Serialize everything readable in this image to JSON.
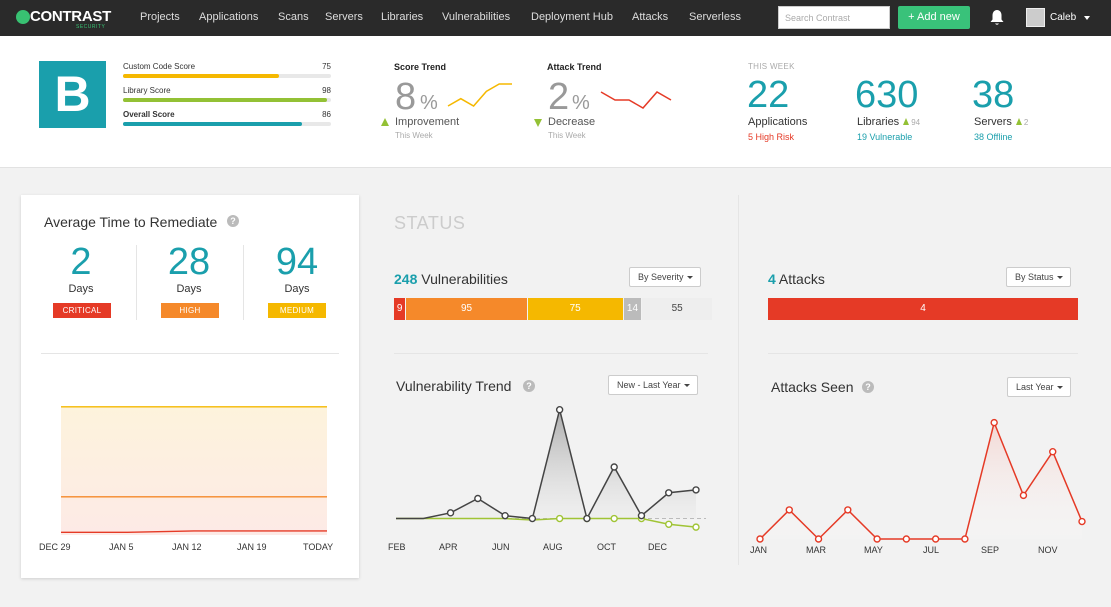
{
  "nav": {
    "logo": "CONTRAST",
    "logo_sub": "SECURITY",
    "items": [
      "Projects",
      "Applications",
      "Scans",
      "Servers",
      "Libraries",
      "Vulnerabilities",
      "Deployment Hub",
      "Attacks",
      "Serverless"
    ],
    "search_placeholder": "Search Contrast",
    "add_new": "+ Add new",
    "user": "Caleb"
  },
  "header": {
    "grade": "B",
    "scores": [
      {
        "label": "Custom Code Score",
        "value": "75",
        "percent": 75,
        "color": "#f5b800",
        "bold": false
      },
      {
        "label": "Library Score",
        "value": "98",
        "percent": 98,
        "color": "#93c135",
        "bold": false
      },
      {
        "label": "Overall Score",
        "value": "86",
        "percent": 86,
        "color": "#1a9fac",
        "bold": true
      }
    ],
    "score_trend": {
      "title": "Score Trend",
      "value": "8",
      "unit": "%",
      "direction": "Improvement",
      "period": "This Week"
    },
    "attack_trend": {
      "title": "Attack Trend",
      "value": "2",
      "unit": "%",
      "direction": "Decrease",
      "period": "This Week"
    },
    "this_week": "THIS WEEK",
    "applications": {
      "value": "22",
      "label": "Applications",
      "sub": "5 High Risk",
      "sub_color": "#e53a26"
    },
    "libraries": {
      "value": "630",
      "label": "Libraries",
      "delta": "94",
      "sub": "19 Vulnerable",
      "sub_color": "#1a9fac"
    },
    "servers": {
      "value": "38",
      "label": "Servers",
      "delta": "2",
      "sub": "38 Offline",
      "sub_color": "#1a9fac"
    }
  },
  "remediate": {
    "title": "Average Time to Remediate",
    "help": "?",
    "items": [
      {
        "value": "2",
        "unit": "Days",
        "badge": "CRITICAL",
        "color": "#e53a26"
      },
      {
        "value": "28",
        "unit": "Days",
        "badge": "HIGH",
        "color": "#f5892a"
      },
      {
        "value": "94",
        "unit": "Days",
        "badge": "MEDIUM",
        "color": "#f5b800"
      }
    ],
    "x_labels": [
      "DEC 29",
      "JAN 5",
      "JAN 12",
      "JAN 19",
      "TODAY"
    ]
  },
  "status": {
    "title": "STATUS",
    "vulns": {
      "count": "248",
      "label": "Vulnerabilities",
      "filter": "By Severity",
      "segments": [
        {
          "value": 9,
          "label": "9",
          "color": "#e53a26",
          "text_color": "#fff"
        },
        {
          "value": 95,
          "label": "95",
          "color": "#f5892a",
          "text_color": "#fff"
        },
        {
          "value": 75,
          "label": "75",
          "color": "#f5b800",
          "text_color": "#fff"
        },
        {
          "value": 14,
          "label": "14",
          "color": "#bbbbbb",
          "text_color": "#fff"
        },
        {
          "value": 55,
          "label": "55",
          "color": "#eeeeee",
          "text_color": "#444"
        }
      ]
    },
    "vuln_trend": {
      "title": "Vulnerability Trend",
      "filter": "New - Last Year",
      "x_labels": [
        "FEB",
        "APR",
        "JUN",
        "AUG",
        "OCT",
        "DEC"
      ]
    },
    "attacks": {
      "count": "4",
      "label": "Attacks",
      "filter": "By Status",
      "bar_value": "4",
      "bar_color": "#e53a26"
    },
    "attacks_seen": {
      "title": "Attacks Seen",
      "filter": "Last Year",
      "x_labels": [
        "JAN",
        "MAR",
        "MAY",
        "JUL",
        "SEP",
        "NOV"
      ]
    }
  },
  "chart_data": [
    {
      "type": "line",
      "title": "Score Trend",
      "series": [
        {
          "values": [
            2,
            3,
            2,
            4,
            5,
            5
          ]
        }
      ]
    },
    {
      "type": "line",
      "title": "Attack Trend",
      "series": [
        {
          "values": [
            5,
            4,
            4,
            3,
            5,
            4
          ]
        }
      ]
    },
    {
      "type": "area",
      "title": "Average Time to Remediate",
      "categories": [
        "DEC 29",
        "JAN 5",
        "JAN 12",
        "JAN 19",
        "TODAY"
      ],
      "series": [
        {
          "values": [
            94,
            94,
            94,
            94,
            94
          ],
          "color": "#f5b800"
        },
        {
          "values": [
            28,
            28,
            28,
            28,
            28
          ],
          "color": "#f5892a"
        },
        {
          "values": [
            2,
            2,
            3,
            3,
            3
          ],
          "color": "#e53a26"
        }
      ],
      "ylim": [
        0,
        110
      ]
    },
    {
      "type": "line",
      "title": "Vulnerability Trend",
      "x_labels": [
        "FEB",
        "APR",
        "JUN",
        "AUG",
        "OCT",
        "DEC"
      ],
      "series": [
        {
          "values": [
            0,
            0,
            2,
            7,
            1,
            0,
            38,
            0,
            18,
            1,
            9,
            10
          ],
          "color": "#444444"
        },
        {
          "values": [
            0,
            0,
            0,
            0,
            0,
            -0.5,
            0,
            0,
            0,
            0,
            -2,
            -3
          ],
          "color": "#a0c435"
        }
      ],
      "ylim": [
        -4,
        40
      ]
    },
    {
      "type": "line",
      "title": "Attacks Seen",
      "x_labels": [
        "JAN",
        "MAR",
        "MAY",
        "JUL",
        "SEP",
        "NOV"
      ],
      "series": [
        {
          "values": [
            0,
            1,
            0,
            1,
            0,
            0,
            0,
            0,
            4,
            1.5,
            3,
            0.6
          ],
          "color": "#e53a26"
        }
      ],
      "ylim": [
        0,
        4.4
      ]
    }
  ]
}
